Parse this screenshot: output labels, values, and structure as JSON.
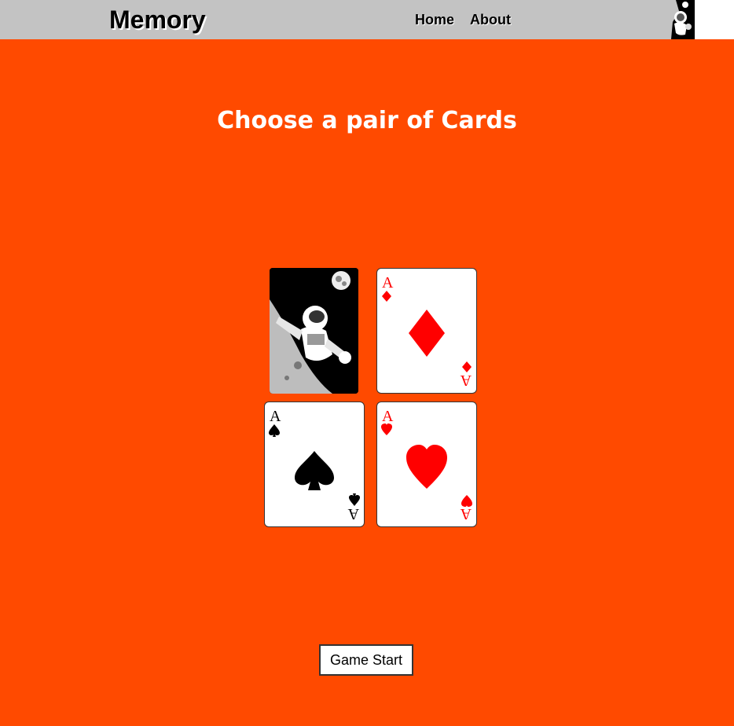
{
  "header": {
    "brand": "Memory",
    "nav": [
      {
        "label": "Home"
      },
      {
        "label": "About"
      }
    ]
  },
  "main": {
    "title": "Choose a pair of Cards",
    "cards": [
      {
        "state": "face-down",
        "image": "astronaut-icon"
      },
      {
        "state": "face-up",
        "rank": "A",
        "suit": "diamonds",
        "suit_glyph": "♦",
        "color": "#ff0000"
      },
      {
        "state": "face-up",
        "rank": "A",
        "suit": "spades",
        "suit_glyph": "♠",
        "color": "#000000"
      },
      {
        "state": "face-up",
        "rank": "A",
        "suit": "hearts",
        "suit_glyph": "♥",
        "color": "#ff0000"
      }
    ],
    "start_button": "Game Start"
  },
  "colors": {
    "page_background": "#ff4a00",
    "header_background": "#c3c3c3",
    "red_suit": "#ff0000",
    "black_suit": "#000000"
  }
}
